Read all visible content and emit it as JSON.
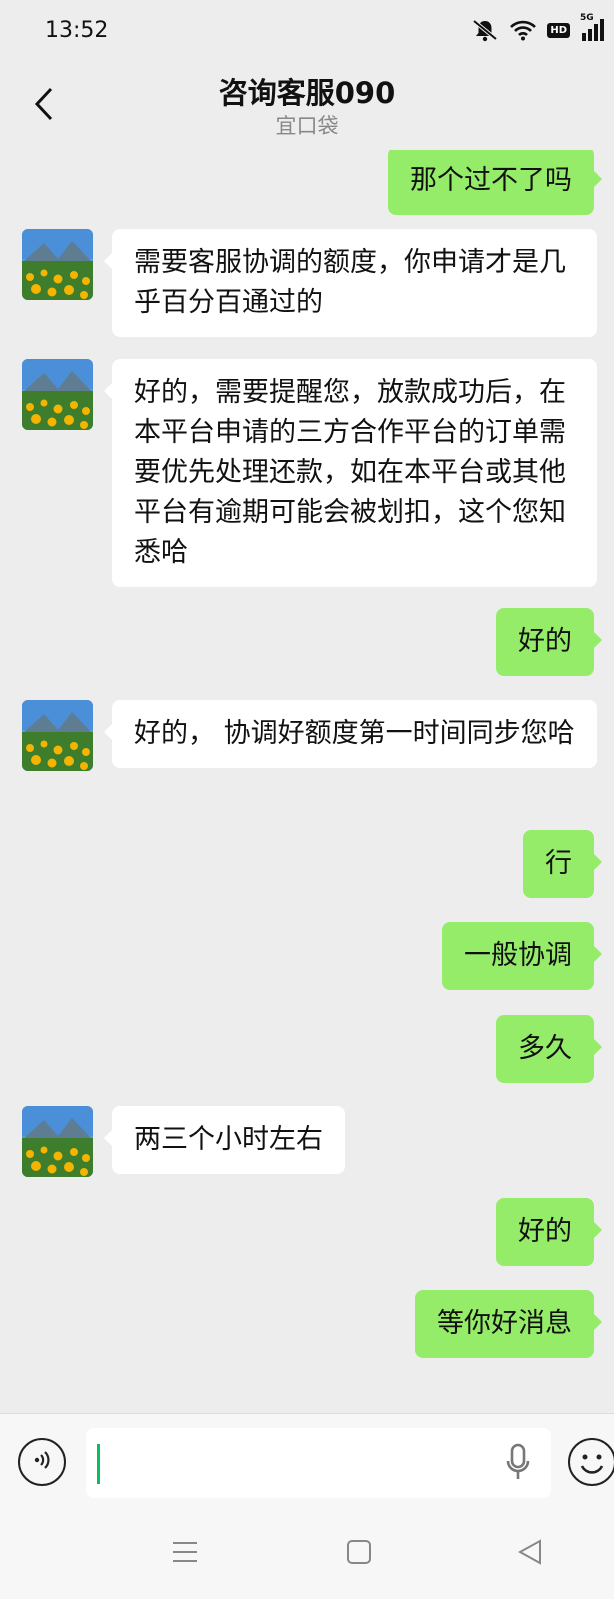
{
  "status_bar": {
    "time": "13:52",
    "hd": "HD",
    "network": "5G"
  },
  "header": {
    "title": "咨询客服090",
    "subtitle": "宜口袋"
  },
  "messages": [
    {
      "side": "out",
      "text": "那个过不了吗"
    },
    {
      "side": "in",
      "text": "需要客服协调的额度，你申请才是几乎百分百通过的"
    },
    {
      "side": "in",
      "text": "好的，需要提醒您，放款成功后，在本平台申请的三方合作平台的订单需要优先处理还款，如在本平台或其他平台有逾期可能会被划扣，这个您知悉哈"
    },
    {
      "side": "out",
      "text": "好的"
    },
    {
      "side": "in",
      "text": "好的， 协调好额度第一时间同步您哈"
    },
    {
      "side": "out",
      "text": "行"
    },
    {
      "side": "out",
      "text": "一般协调"
    },
    {
      "side": "out",
      "text": "多久"
    },
    {
      "side": "in",
      "text": "两三个小时左右"
    },
    {
      "side": "out",
      "text": "好的"
    },
    {
      "side": "out",
      "text": "等你好消息"
    }
  ],
  "input": {
    "value": "",
    "placeholder": ""
  },
  "colors": {
    "background": "#ededed",
    "outgoing_bubble": "#95ec69",
    "incoming_bubble": "#ffffff",
    "caret": "#07c160"
  },
  "icons": [
    "back-icon",
    "mute-icon",
    "wifi-icon",
    "signal-icon",
    "voice-icon",
    "microphone-icon",
    "emoji-icon",
    "menu-icon",
    "home-icon",
    "back-triangle-icon"
  ]
}
